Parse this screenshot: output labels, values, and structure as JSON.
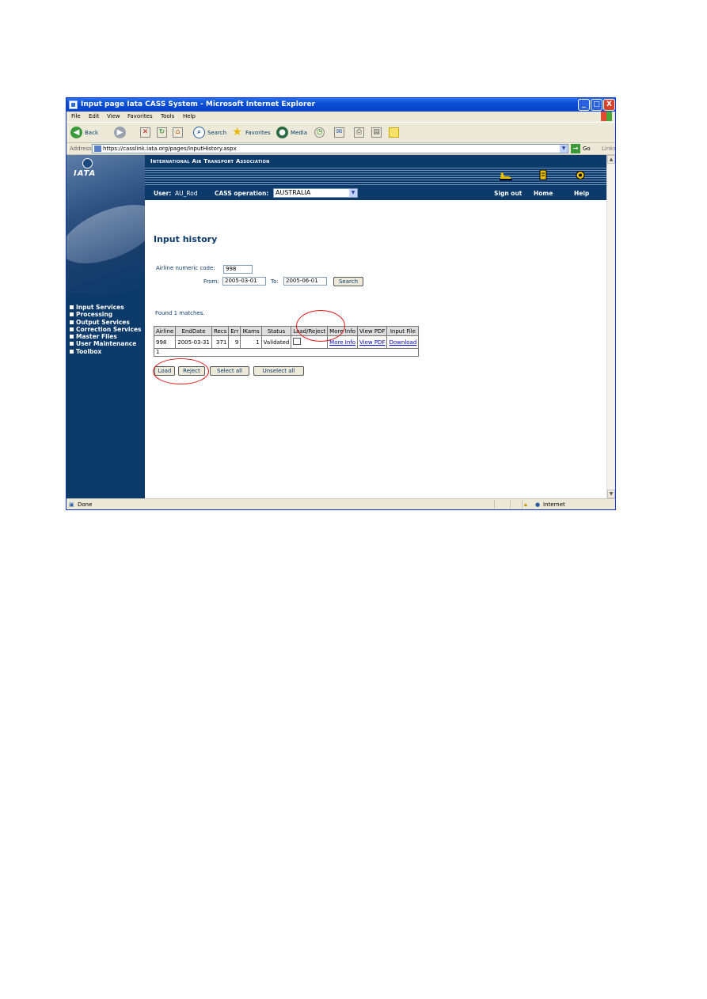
{
  "window": {
    "title": "Input page Iata CASS System - Microsoft Internet Explorer",
    "minimize": "_",
    "maximize": "□",
    "close": "X"
  },
  "menu": {
    "file": "File",
    "edit": "Edit",
    "view": "View",
    "favorites": "Favorites",
    "tools": "Tools",
    "help": "Help"
  },
  "toolbar": {
    "back": "Back",
    "search": "Search",
    "favorites": "Favorites",
    "media": "Media"
  },
  "address": {
    "label": "Address",
    "url": "https://casslink.iata.org/pages/InputHistory.aspx",
    "go": "Go",
    "links": "Links"
  },
  "sidebar": {
    "logo_text": "IATA",
    "items": [
      {
        "label": "Input Services"
      },
      {
        "label": "Processing"
      },
      {
        "label": "Output Services"
      },
      {
        "label": "Correction Services"
      },
      {
        "label": "Master Files"
      },
      {
        "label": "User Maintenance"
      },
      {
        "label": "Toolbox"
      }
    ]
  },
  "banner": {
    "org": "International Air Transport Association",
    "user_label": "User:",
    "user_value": "AU_Rod",
    "cass_label": "CASS operation:",
    "cass_value": "AUSTRALIA",
    "signout": "Sign out",
    "home": "Home",
    "help": "Help"
  },
  "page": {
    "title": "Input history",
    "airline_label": "Airline numeric code:",
    "airline_value": "998",
    "from_label": "From:",
    "from_value": "2005-03-01",
    "to_label": "To:",
    "to_value": "2005-06-01",
    "search_btn": "Search",
    "found_text": "Found 1 matches."
  },
  "table": {
    "headers": [
      "Airline",
      "EndDate",
      "Recs",
      "Err",
      "IKams",
      "Status",
      "Load/Reject",
      "More Info",
      "View PDF",
      "Input File"
    ],
    "row": {
      "airline": "998",
      "enddate": "2005-03-31",
      "recs": "371",
      "err": "9",
      "ikams": "1",
      "status": "Validated",
      "more_info": "More Info",
      "view_pdf": "View PDF",
      "input_file": "Download"
    },
    "pager": "1"
  },
  "actions": {
    "load": "Load",
    "reject": "Reject",
    "select_all": "Select all",
    "unselect_all": "Unselect all"
  },
  "status": {
    "text": "Done",
    "zone": "Internet"
  },
  "colors": {
    "brand_navy": "#0b3a6b",
    "annotation_red": "#e01818",
    "xp_title": "#0a4fd6"
  }
}
